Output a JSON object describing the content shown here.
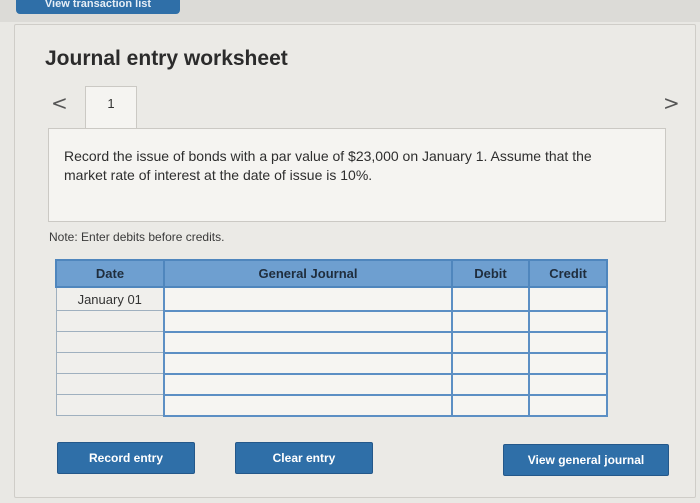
{
  "top_tab": {
    "label": "View transaction list"
  },
  "worksheet": {
    "title": "Journal entry worksheet",
    "page_number": "1",
    "prev_symbol": "<",
    "next_symbol": ">",
    "instruction": "Record the issue of bonds with a par value of $23,000 on January 1. Assume that the market rate of interest at the date of issue is 10%.",
    "note": "Note: Enter debits before credits."
  },
  "table": {
    "headers": {
      "date": "Date",
      "journal": "General Journal",
      "debit": "Debit",
      "credit": "Credit"
    },
    "rows": [
      {
        "date": "January 01"
      },
      {
        "date": ""
      },
      {
        "date": ""
      },
      {
        "date": ""
      },
      {
        "date": ""
      },
      {
        "date": ""
      }
    ]
  },
  "buttons": {
    "record": "Record entry",
    "clear": "Clear entry",
    "view_journal": "View general journal"
  },
  "colors": {
    "button_blue": "#2f6fa8",
    "header_blue": "#6e9fd0",
    "input_border": "#5c8fc4"
  }
}
